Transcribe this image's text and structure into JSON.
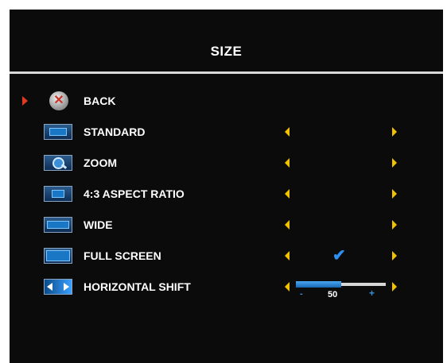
{
  "menu": {
    "title": "SIZE",
    "items": [
      {
        "label": "BACK",
        "icon": "back-icon",
        "selected": true
      },
      {
        "label": "STANDARD",
        "icon": "standard-display-icon"
      },
      {
        "label": "ZOOM",
        "icon": "zoom-magnifier-icon"
      },
      {
        "label": "4:3 ASPECT RATIO",
        "icon": "aspect-ratio-icon"
      },
      {
        "label": "WIDE",
        "icon": "wide-display-icon"
      },
      {
        "label": "FULL SCREEN",
        "icon": "full-screen-icon",
        "checked": true
      },
      {
        "label": "HORIZONTAL SHIFT",
        "icon": "horizontal-shift-icon"
      }
    ],
    "horizontal_shift": {
      "value": "50",
      "fraction": 0.5,
      "min_label": "-",
      "max_label": "+"
    }
  },
  "colors": {
    "background": "#0b0b0b",
    "text": "#ffffff",
    "arrow": "#f2c200",
    "selection_marker": "#e03a20",
    "accent": "#2f8ff0"
  }
}
